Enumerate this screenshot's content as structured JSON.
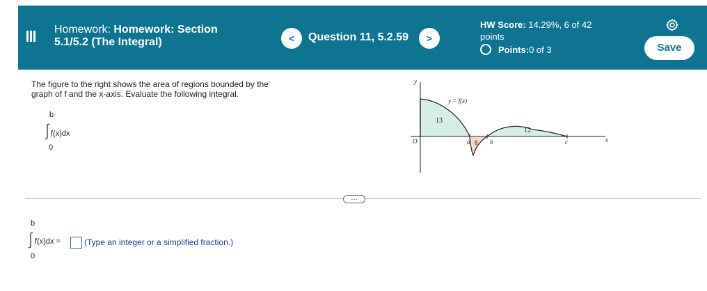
{
  "header": {
    "title_line1_prefix": "Homework: ",
    "title_line1_bold": "Homework: Section",
    "title_line2": "5.1/5.2 (The Integral)",
    "prev_label": "<",
    "next_label": ">",
    "question": "Question 11, 5.2.59",
    "score_label": "HW Score:",
    "score_value": " 14.29%, 6 of 42",
    "score_line2": "points",
    "points_label": "Points:",
    "points_value": " 0 of 3",
    "save_label": "Save",
    "accent": "#0e7492"
  },
  "problem": {
    "text_line1": "The figure to the right shows the area of regions bounded by the",
    "text_line2": "graph of f and the x-axis. Evaluate the following integral.",
    "upper": "b",
    "integrand": "f(x)dx",
    "lower": "0"
  },
  "graph": {
    "y_label": "y",
    "x_label": "x",
    "origin": "O",
    "func_label": "y = f(x)",
    "area1": "13",
    "area2": "8",
    "area3": "12",
    "a": "a",
    "b": "b",
    "c": "c"
  },
  "more_label": "…",
  "answer": {
    "upper": "b",
    "integrand": "f(x)dx =",
    "lower": "0",
    "hint": "(Type an integer or a simplified fraction.)"
  }
}
